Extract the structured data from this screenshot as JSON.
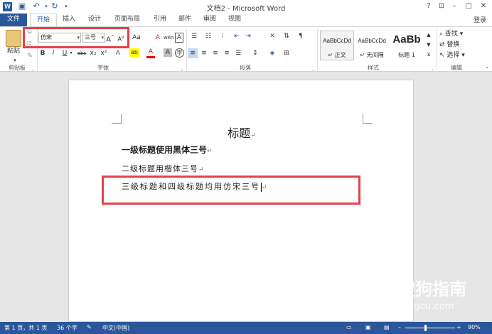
{
  "titlebar": {
    "title": "文档2 - Microsoft Word",
    "help": "?",
    "ribbon_opts": "⊡",
    "minimize": "–",
    "restore": "□",
    "close": "✕"
  },
  "tabs": [
    {
      "label": "文件"
    },
    {
      "label": "开始"
    },
    {
      "label": "插入"
    },
    {
      "label": "设计"
    },
    {
      "label": "页面布局"
    },
    {
      "label": "引用"
    },
    {
      "label": "邮件"
    },
    {
      "label": "审阅"
    },
    {
      "label": "视图"
    }
  ],
  "login": "登录",
  "clipboard": {
    "paste": "粘贴",
    "group": "剪贴板"
  },
  "font": {
    "name": "仿宋",
    "size": "三号",
    "grow": "A",
    "shrink": "A",
    "case": "Aa",
    "clear": "A",
    "phonetic": "wén",
    "border": "A",
    "bold": "B",
    "italic": "I",
    "underline": "U",
    "strike": "abc",
    "sub": "x₂",
    "sup": "x²",
    "effects": "A",
    "highlight": "ab",
    "color": "A",
    "shade": "A",
    "circle": "字",
    "group": "字体"
  },
  "paragraph": {
    "group": "段落"
  },
  "styles": {
    "group": "样式",
    "items": [
      {
        "sample": "AaBbCcDd",
        "name": "↵ 正文"
      },
      {
        "sample": "AaBbCcDd",
        "name": "↵ 无间隔"
      },
      {
        "sample": "AaBb",
        "name": "标题 1"
      }
    ]
  },
  "editing": {
    "group": "编辑",
    "find": "查找",
    "replace": "替换",
    "select": "选择"
  },
  "document": {
    "title": "标题",
    "line1": "一级标题使用黑体三号",
    "line2": "二级标题用楷体三号",
    "line3": "三级标题和四级标题均用仿宋三号",
    "para_mark": "↵"
  },
  "statusbar": {
    "page": "第 1 页，共 1 页",
    "words": "36 个字",
    "lang": "中文(中国)",
    "zoom": "90%"
  },
  "watermark": {
    "cn": "搜狗指南",
    "url": "zhinan.sogou.com"
  },
  "colors": {
    "accent": "#2b579a",
    "highlight_box": "#e64047"
  }
}
